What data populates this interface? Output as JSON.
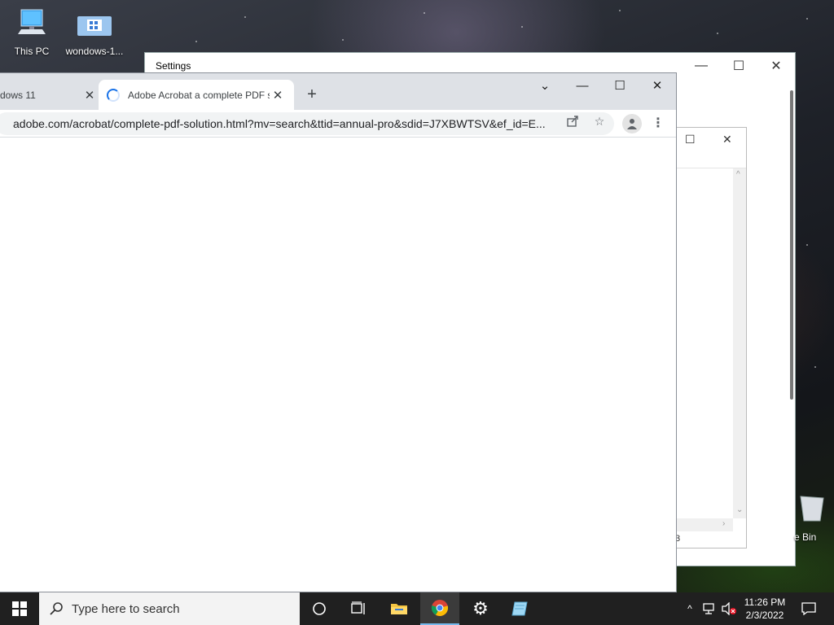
{
  "desktop": {
    "icons": [
      {
        "label": "This PC",
        "icon": "this-pc-icon"
      },
      {
        "label": "wondows-1...",
        "icon": "network-drive-icon"
      }
    ],
    "recycle_bin_label": "e Bin"
  },
  "settings_window": {
    "title": "Settings"
  },
  "small_window": {
    "status_text": "3"
  },
  "browser": {
    "tabs": [
      {
        "title": "dows 11",
        "active": false
      },
      {
        "title": "Adobe Acrobat a complete PDF s",
        "active": true,
        "loading": true
      }
    ],
    "new_tab_label": "+",
    "url": "adobe.com/acrobat/complete-pdf-solution.html?mv=search&ttid=annual-pro&sdid=J7XBWTSV&ef_id=E...",
    "colors": {
      "tabstrip": "#dee1e6",
      "spinner": "#1a73e8",
      "omnibox": "#f1f3f4"
    }
  },
  "taskbar": {
    "search_placeholder": "Type here to search",
    "pinned": [
      {
        "name": "cortana",
        "icon": "cortana-circle-icon"
      },
      {
        "name": "task-view",
        "icon": "task-view-icon"
      },
      {
        "name": "file-explorer",
        "icon": "folder-icon"
      },
      {
        "name": "chrome",
        "icon": "chrome-icon",
        "active": true
      },
      {
        "name": "settings",
        "icon": "gear-icon"
      },
      {
        "name": "notepad-app",
        "icon": "app-icon"
      }
    ],
    "clock": {
      "time": "11:26 PM",
      "date": "2/3/2022"
    }
  }
}
